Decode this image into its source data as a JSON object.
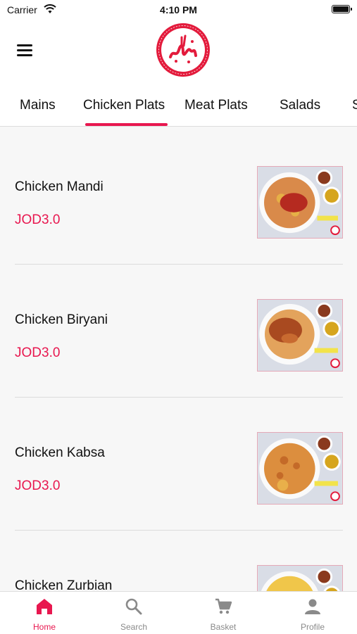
{
  "colors": {
    "accent": "#e8174f",
    "inactive": "#8a8a8a"
  },
  "status_bar": {
    "carrier": "Carrier",
    "time": "4:10 PM"
  },
  "header": {
    "menu_icon": "hamburger-menu-icon",
    "logo_icon": "restaurant-logo"
  },
  "tabs": [
    {
      "label": "Mains"
    },
    {
      "label": "Chicken Plats",
      "active": true
    },
    {
      "label": "Meat Plats"
    },
    {
      "label": "Salads"
    },
    {
      "label": "S"
    }
  ],
  "items": [
    {
      "name": "Chicken Mandi",
      "price": "JOD3.0"
    },
    {
      "name": "Chicken Biryani",
      "price": "JOD3.0"
    },
    {
      "name": "Chicken Kabsa",
      "price": "JOD3.0"
    },
    {
      "name": "Chicken Zurbian",
      "price": ""
    }
  ],
  "bottom_nav": [
    {
      "label": "Home",
      "icon": "home-icon",
      "active": true
    },
    {
      "label": "Search",
      "icon": "search-icon"
    },
    {
      "label": "Basket",
      "icon": "cart-icon"
    },
    {
      "label": "Profile",
      "icon": "profile-icon"
    }
  ]
}
